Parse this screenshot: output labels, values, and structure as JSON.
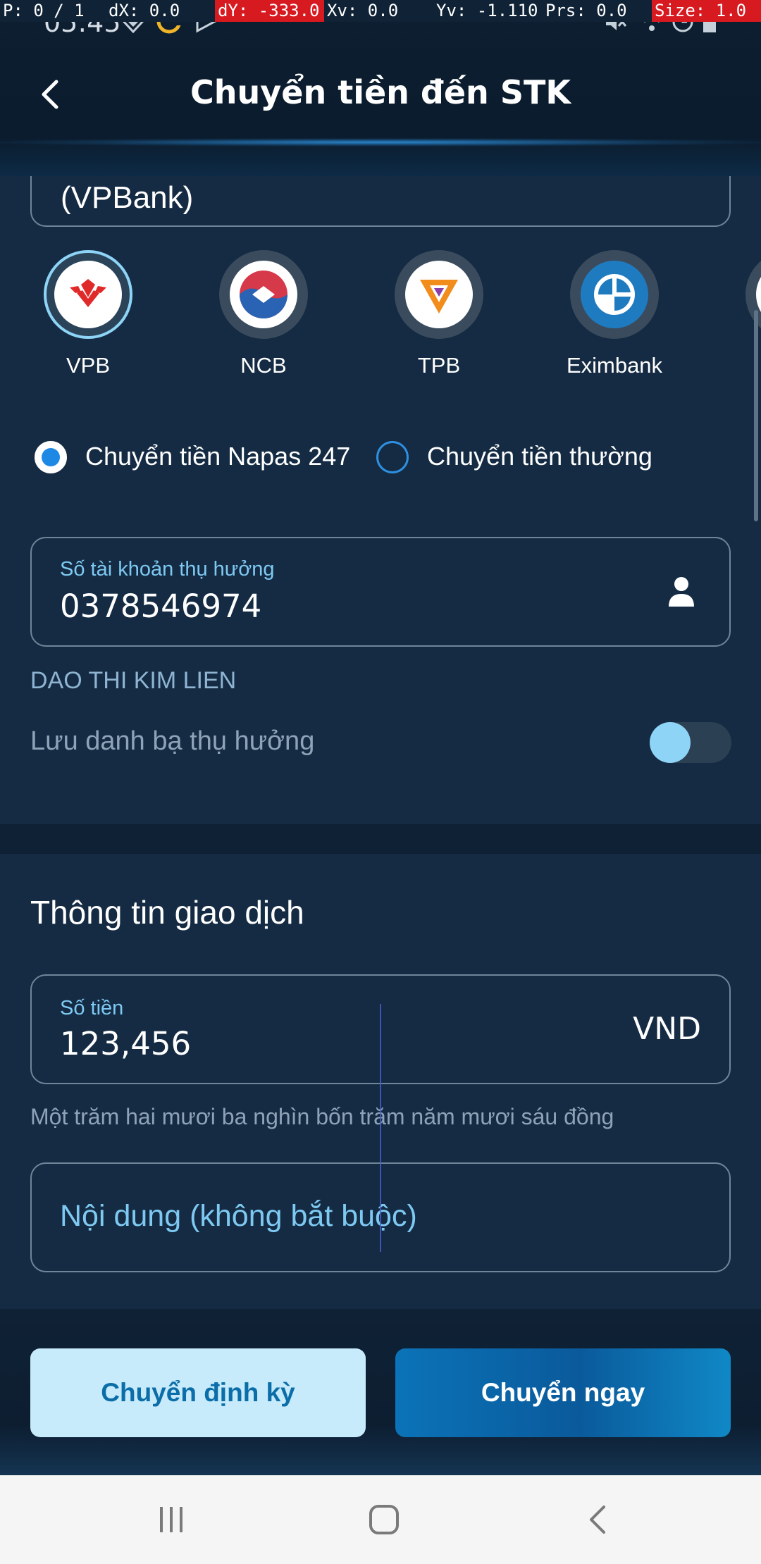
{
  "debug": {
    "pointer": "P: 0 / 1",
    "dx": "dX: 0.0",
    "dy": "dY: -333.0",
    "xv": "Xv: 0.0",
    "yv": "Yv: -1.110",
    "prs": "Prs: 0.0",
    "size": "Size: 1.0"
  },
  "status_bar": {
    "time": "05:45",
    "icons": [
      "shield-icon",
      "c-app-icon",
      "play-icon",
      "mute-icon",
      "wifi-icon",
      "alarm-icon",
      "battery-icon"
    ]
  },
  "header": {
    "title": "Chuyển tiền đến STK",
    "back_icon": "chevron-left-icon"
  },
  "bank_field": {
    "value": "(VPBank)"
  },
  "banks": [
    {
      "code": "VPB",
      "selected": true,
      "color": "#e02a2a"
    },
    {
      "code": "NCB",
      "selected": false,
      "color": "#2a63b3"
    },
    {
      "code": "TPB",
      "selected": false,
      "color": "#f28c1b"
    },
    {
      "code": "Eximbank",
      "selected": false,
      "color": "#1f7bc0"
    }
  ],
  "transfer_type": {
    "options": [
      {
        "label": "Chuyển tiền Napas 247",
        "selected": true
      },
      {
        "label": "Chuyển tiền thường",
        "selected": false
      }
    ]
  },
  "account": {
    "label": "Số tài khoản thụ hưởng",
    "value": "0378546974",
    "contact_icon": "person-icon",
    "holder_name": "DAO THI KIM LIEN",
    "save_contact_label": "Lưu danh bạ thụ hưởng",
    "save_contact_on": false
  },
  "transaction": {
    "section_title": "Thông tin giao dịch",
    "amount_label": "Số tiền",
    "amount_value": "123,456",
    "currency": "VND",
    "amount_in_words": "Một trăm hai mươi ba nghìn bốn trăm năm mươi sáu đồng",
    "note_placeholder": "Nội dung (không bắt buộc)"
  },
  "actions": {
    "schedule_label": "Chuyển định kỳ",
    "transfer_now_label": "Chuyển ngay"
  },
  "colors": {
    "background": "#142b43",
    "accent": "#7ec9f2",
    "primary_button": "#0a5a9b",
    "secondary_button": "#c8ebfb"
  },
  "nav_bar": {
    "icons": [
      "recent-apps-icon",
      "home-icon",
      "back-icon"
    ]
  }
}
